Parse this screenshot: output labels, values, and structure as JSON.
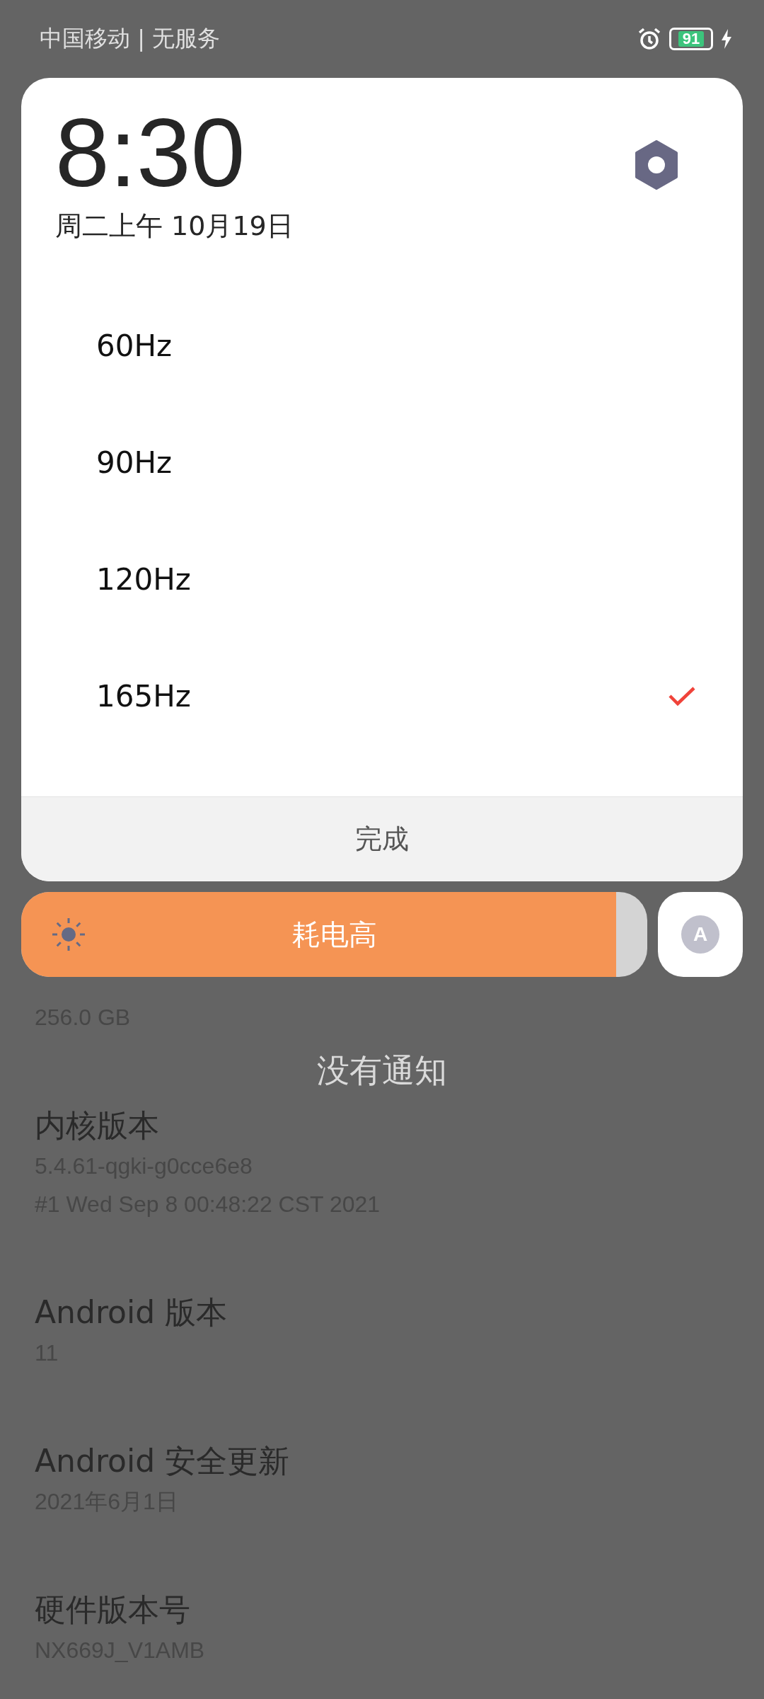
{
  "status_bar": {
    "carrier": "中国移动 | 无服务",
    "battery": "91"
  },
  "panel": {
    "time": "8:30",
    "date": "周二上午 10月19日",
    "options": [
      {
        "label": "60Hz",
        "selected": false
      },
      {
        "label": "90Hz",
        "selected": false
      },
      {
        "label": "120Hz",
        "selected": false
      },
      {
        "label": "165Hz",
        "selected": true
      }
    ],
    "done_button": "完成"
  },
  "brightness": {
    "level": 0.95,
    "label": "耗电高",
    "auto_button": "A"
  },
  "notice": "没有通知",
  "settings_list": [
    {
      "values": [
        "256.0 GB"
      ]
    },
    {
      "title": "内核版本",
      "values": [
        "5.4.61-qgki-g0cce6e8",
        "#1 Wed Sep 8 00:48:22 CST 2021"
      ]
    },
    {
      "title": "Android 版本",
      "values": [
        "11"
      ]
    },
    {
      "title": "Android 安全更新",
      "values": [
        "2021年6月1日"
      ]
    },
    {
      "title": "硬件版本号",
      "values": [
        "NX669J_V1AMB"
      ]
    }
  ]
}
